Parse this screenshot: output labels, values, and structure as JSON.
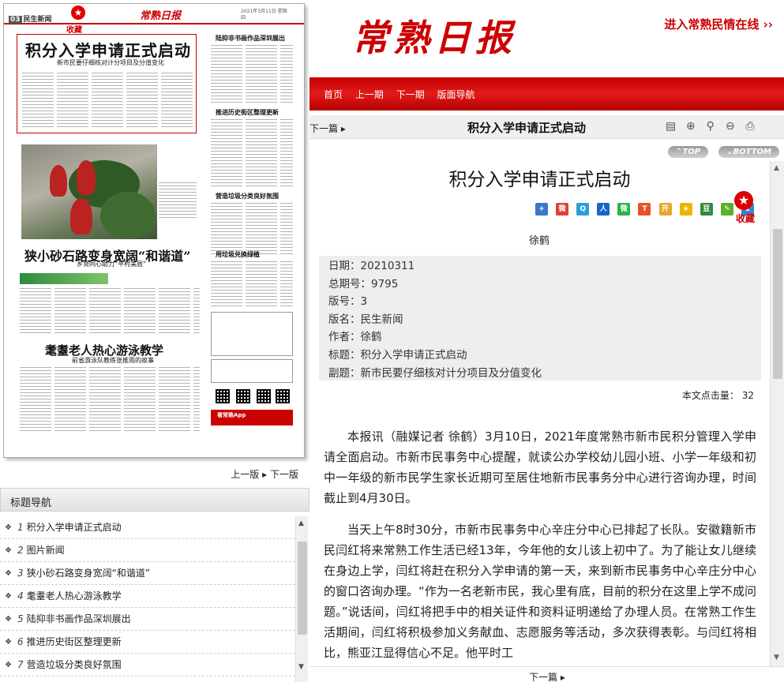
{
  "newspaper_page": {
    "page_label": "民生新闻",
    "page_box": "03",
    "favorite_label": "收藏",
    "logo_small": "常熟日报",
    "date_small": "2021年3月11日 星期四",
    "article1_title": "积分入学申请正式启动",
    "article1_sub": "新市民要仔细核对计分项目及分值变化",
    "article3_title": "狭小砂石路变身宽阔“和谐道”",
    "article3_sub": "乡贤同心助力“平村美居”",
    "article4_title": "耄耋老人热心游泳教学",
    "article4_sub": "前省游泳队教练张推雨的故事",
    "right_col_head1": "陆抑非书画作品深圳展出",
    "right_col_head2": "推进历史街区整理更新",
    "right_col_head3": "营造垃圾分类良好氛围",
    "right_col_head4": "用垃圾兑换绿植",
    "app_banner": "看常熟App"
  },
  "page_nav": {
    "prev": "上一版",
    "next": "下一版"
  },
  "toc": {
    "title": "标题导航",
    "items": [
      {
        "num": "1",
        "label": "积分入学申请正式启动"
      },
      {
        "num": "2",
        "label": "图片新闻"
      },
      {
        "num": "3",
        "label": "狭小砂石路变身宽阔“和谐道”"
      },
      {
        "num": "4",
        "label": "耄耋老人热心游泳教学"
      },
      {
        "num": "5",
        "label": "陆抑非书画作品深圳展出"
      },
      {
        "num": "6",
        "label": "推进历史街区整理更新"
      },
      {
        "num": "7",
        "label": "营造垃圾分类良好氛围"
      }
    ]
  },
  "masthead": {
    "logo": "常熟日报",
    "minqing_link": "进入常熟民情在线 ››"
  },
  "navbar": {
    "items": [
      "首页",
      "上一期",
      "下一期",
      "版面导航"
    ]
  },
  "title_bar": {
    "next_link": "下一篇 ▸",
    "title": "积分入学申请正式启动"
  },
  "top_buttons": {
    "top": "⌃TOP",
    "bottom": "⌄BOTTOM"
  },
  "article": {
    "title": "积分入学申请正式启动",
    "favorite_label": "收藏",
    "byline": "徐鹤",
    "meta": [
      {
        "key": "日期：",
        "value": "20210311"
      },
      {
        "key": "总期号：",
        "value": "9795"
      },
      {
        "key": "版号：",
        "value": "3"
      },
      {
        "key": "版名：",
        "value": "民生新闻"
      },
      {
        "key": "作者：",
        "value": "徐鹤"
      },
      {
        "key": "标题：",
        "value": "积分入学申请正式启动"
      },
      {
        "key": "副题：",
        "value": "新市民要仔细核对计分项目及分值变化"
      }
    ],
    "hits_label": "本文点击量：",
    "hits_value": "32",
    "paragraphs": [
      "本报讯（融媒记者 徐鹤）3月10日，2021年度常熟市新市民积分管理入学申请全面启动。市新市民事务中心提醒，就读公办学校幼儿园小班、小学一年级和初中一年级的新市民学生家长近期可至居住地新市民事务分中心进行咨询办理，时间截止到4月30日。",
      "当天上午8时30分，市新市民事务中心辛庄分中心已排起了长队。安徽籍新市民闫红将来常熟工作生活已经13年，今年他的女儿该上初中了。为了能让女儿继续在身边上学，闫红将赶在积分入学申请的第一天，来到新市民事务中心辛庄分中心的窗口咨询办理。“作为一名老新市民，我心里有底，目前的积分在这里上学不成问题。”说话间，闫红将把手中的相关证件和资料证明递给了办理人员。在常熟工作生活期间，闫红将积极参加义务献血、志愿服务等活动，多次获得表彰。与闫红将相比，熊亚江显得信心不足。他平时工"
    ]
  },
  "bottom": {
    "next_link": "下一篇 ▸"
  }
}
